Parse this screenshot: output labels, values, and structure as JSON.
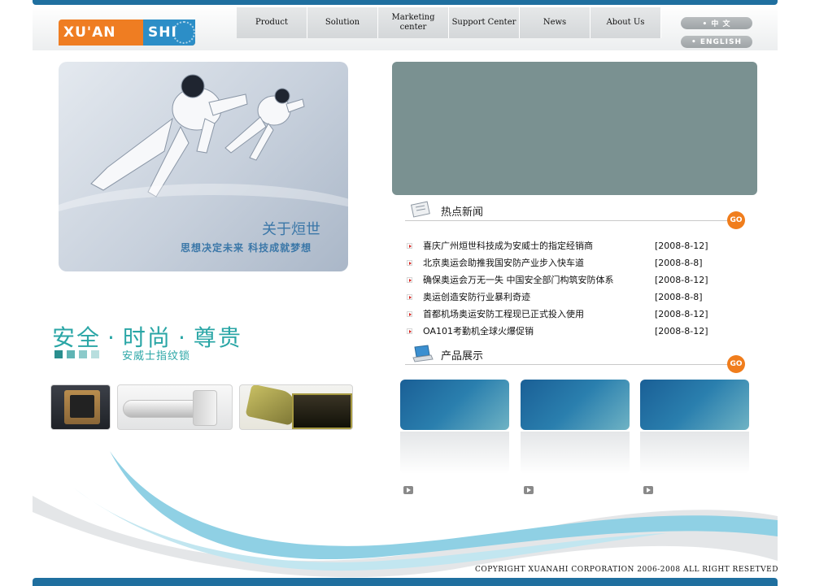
{
  "header": {
    "logo": {
      "part1": "XU'AN",
      "part2": "SHI"
    },
    "nav": [
      {
        "label": "Product"
      },
      {
        "label": "Solution"
      },
      {
        "label": "Marketing center"
      },
      {
        "label": "Support Center"
      },
      {
        "label": "News"
      },
      {
        "label": "About Us"
      }
    ],
    "lang": {
      "cn": "• 中 文",
      "en": "• ENGLISH"
    }
  },
  "hero": {
    "title": "关于烜世",
    "slogan": "思想决定未来   科技成就梦想"
  },
  "news": {
    "heading": "热点新闻",
    "go": "GO",
    "items": [
      {
        "title": "喜庆广州烜世科技成为安威士的指定经销商",
        "date": "[2008-8-12]"
      },
      {
        "title": "北京奥运会助推我国安防产业步入快车道",
        "date": "[2008-8-8]"
      },
      {
        "title": "确保奥运会万无一失 中国安全部门构筑安防体系",
        "date": "[2008-8-12]"
      },
      {
        "title": "奥运创造安防行业暴利奇迹",
        "date": "[2008-8-8]"
      },
      {
        "title": "首都机场奥运安防工程现已正式投入使用",
        "date": "[2008-8-12]"
      },
      {
        "title": "OA101考勤机全球火爆促销",
        "date": "[2008-8-12]"
      }
    ]
  },
  "products": {
    "heading": "产品展示",
    "go": "GO",
    "count": 3
  },
  "promo": {
    "slogan_parts": [
      "安全",
      "时尚",
      "尊贵"
    ],
    "separator": "·",
    "sub": "安威士指纹锁",
    "square_colors": [
      "#2a8e8e",
      "#5fb4b4",
      "#8ccaca",
      "#b8dede"
    ]
  },
  "footer": {
    "copyright": "COPYRIGHT XUANAHI CORPORATION 2006-2008 ALL RIGHT RESETVED"
  },
  "colors": {
    "accent_blue": "#1f6f9f",
    "teal": "#2aa6a6",
    "orange": "#f07d1c",
    "panel_gray": "#7a9191"
  }
}
